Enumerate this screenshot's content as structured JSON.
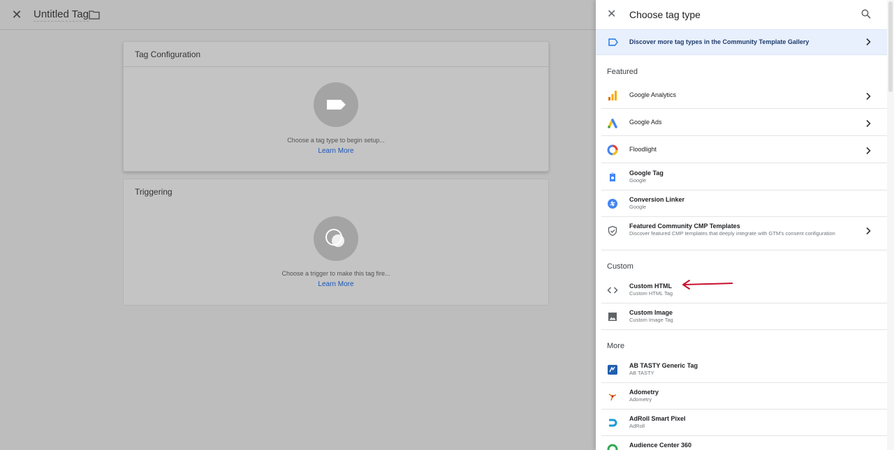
{
  "editor": {
    "title": "Untitled Tag",
    "tag_config_title": "Tag Configuration",
    "tag_config_hint": "Choose a tag type to begin setup...",
    "tag_config_learn": "Learn More",
    "triggering_title": "Triggering",
    "triggering_hint": "Choose a trigger to make this tag fire...",
    "triggering_learn": "Learn More"
  },
  "panel": {
    "title": "Choose tag type",
    "discover": "Discover more tag types in the Community Template Gallery",
    "featured_label": "Featured",
    "featured": [
      {
        "name": "Google Analytics",
        "icon": "google-analytics-icon"
      },
      {
        "name": "Google Ads",
        "icon": "google-ads-icon"
      },
      {
        "name": "Floodlight",
        "icon": "floodlight-icon"
      },
      {
        "name": "Google Tag",
        "sub": "Google",
        "icon": "google-tag-icon"
      },
      {
        "name": "Conversion Linker",
        "sub": "Google",
        "icon": "conversion-linker-icon"
      },
      {
        "name": "Featured Community CMP Templates",
        "sub": "Discover featured CMP templates that deeply integrate with GTM's consent configuration",
        "icon": "shield-check-icon"
      }
    ],
    "custom_label": "Custom",
    "custom": [
      {
        "name": "Custom HTML",
        "sub": "Custom HTML Tag",
        "icon": "code-icon"
      },
      {
        "name": "Custom Image",
        "sub": "Custom Image Tag",
        "icon": "image-icon"
      }
    ],
    "more_label": "More",
    "more": [
      {
        "name": "AB TASTY Generic Tag",
        "sub": "AB TASTY",
        "icon": "ab-tasty-icon"
      },
      {
        "name": "Adometry",
        "sub": "Adometry",
        "icon": "adometry-icon"
      },
      {
        "name": "AdRoll Smart Pixel",
        "sub": "AdRoll",
        "icon": "adroll-icon"
      },
      {
        "name": "Audience Center 360",
        "icon": "audience-center-icon"
      }
    ]
  },
  "colors": {
    "accent": "#1a73e8",
    "annotation_arrow": "#c8102e",
    "discover_bg": "#e8f0fe"
  }
}
